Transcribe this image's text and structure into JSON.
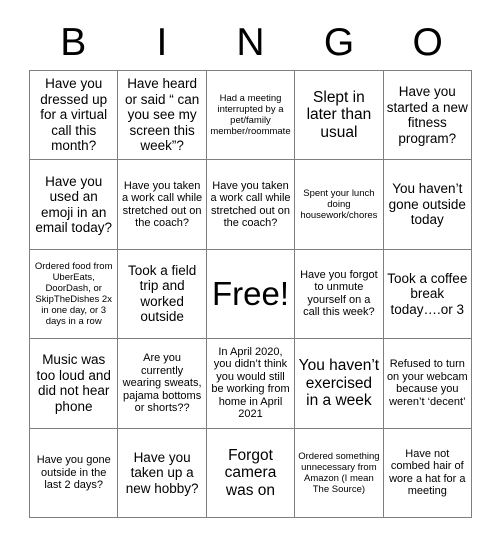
{
  "header": {
    "letters": [
      "B",
      "I",
      "N",
      "G",
      "O"
    ]
  },
  "grid": {
    "rows": 5,
    "columns": 5,
    "border_color": "#7f7f7f",
    "background_color": "#ffffff",
    "text_color": "#000000",
    "cells": [
      {
        "text": "Have you dressed up for a virtual call this month?",
        "size": "md"
      },
      {
        "text": "Have heard or said “ can you see my screen this week”?",
        "size": "md"
      },
      {
        "text": "Had a meeting interrupted by a pet/family member/roommate",
        "size": "xs"
      },
      {
        "text": "Slept in later than usual",
        "size": "lg"
      },
      {
        "text": "Have you started a new fitness program?",
        "size": "md"
      },
      {
        "text": "Have you used an emoji in an email today?",
        "size": "md"
      },
      {
        "text": "Have you taken a work call while stretched out on the coach?",
        "size": "sm"
      },
      {
        "text": "Have you taken a work call while stretched out on the coach?",
        "size": "sm"
      },
      {
        "text": "Spent your lunch doing housework/chores",
        "size": "xs"
      },
      {
        "text": "You haven’t gone outside today",
        "size": "md"
      },
      {
        "text": "Ordered food from UberEats, DoorDash, or SkipTheDishes 2x in one day, or 3 days in a row",
        "size": "xs"
      },
      {
        "text": "Took a field trip and worked outside",
        "size": "md"
      },
      {
        "text": "Free!",
        "size": "free"
      },
      {
        "text": "Have you forgot to unmute yourself on a call this week?",
        "size": "sm"
      },
      {
        "text": "Took a coffee break today….or 3",
        "size": "md"
      },
      {
        "text": "Music was too loud and did not hear phone",
        "size": "md"
      },
      {
        "text": "Are you currently wearing sweats, pajama bottoms or shorts??",
        "size": "sm"
      },
      {
        "text": "In April 2020, you didn’t think you would still be working from home in April 2021",
        "size": "sm"
      },
      {
        "text": "You haven’t exercised in a week",
        "size": "lg"
      },
      {
        "text": "Refused to turn on your webcam because you weren’t ‘decent’",
        "size": "sm"
      },
      {
        "text": "Have you gone outside in the last 2 days?",
        "size": "sm"
      },
      {
        "text": "Have you taken up a new hobby?",
        "size": "md"
      },
      {
        "text": "Forgot camera was on",
        "size": "lg"
      },
      {
        "text": "Ordered something unnecessary from Amazon (I mean The Source)",
        "size": "xs"
      },
      {
        "text": "Have not combed hair of wore a hat for a meeting",
        "size": "sm"
      }
    ]
  }
}
